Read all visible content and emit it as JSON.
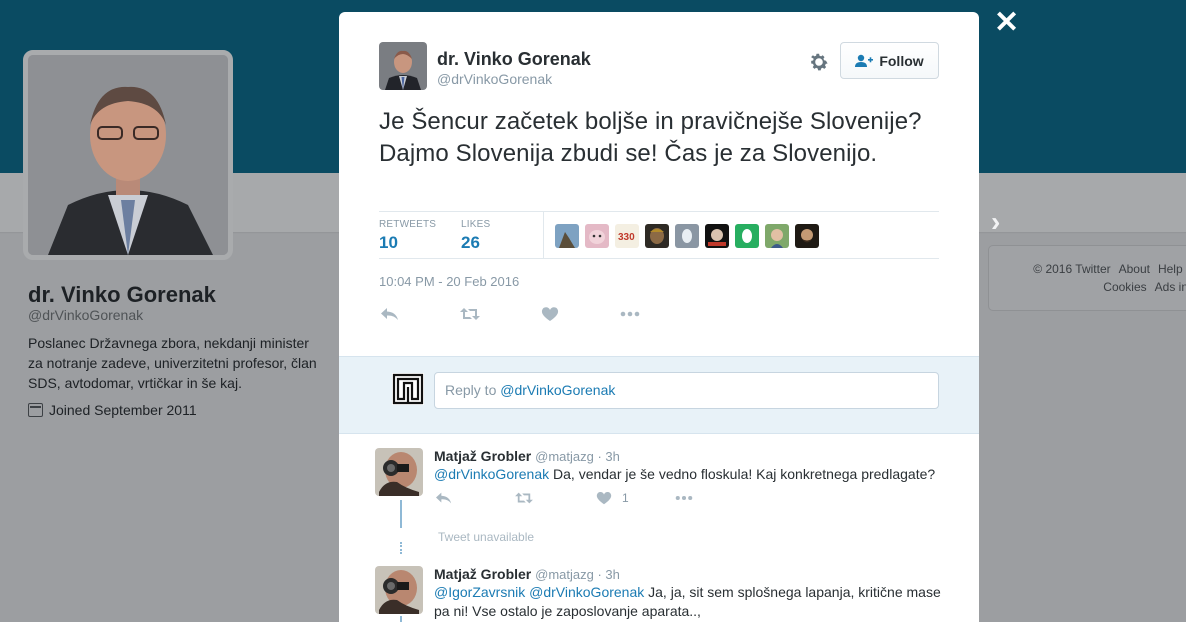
{
  "profile": {
    "name": "dr. Vinko Gorenak",
    "handle": "@drVinkoGorenak",
    "bio": "Poslanec Državnega zbora, nekdanji minister za notranje zadeve, univerzitetni profesor, član SDS, avtodomar, vrtičkar in še kaj.",
    "joined": "Joined September 2011"
  },
  "footer": {
    "line1": [
      "© 2016 Twitter",
      "About",
      "Help",
      "T"
    ],
    "line2": [
      "Cookies",
      "Ads info"
    ]
  },
  "modal": {
    "author_name": "dr. Vinko Gorenak",
    "author_handle": "@drVinkoGorenak",
    "follow_label": "Follow",
    "tweet_text": "Je Šencur začetek boljše in pravičnejše Slovenije? Dajmo Slovenija zbudi se! Čas je za Slovenijo.",
    "retweets_label": "RETWEETS",
    "retweets_count": "10",
    "likes_label": "LIKES",
    "likes_count": "26",
    "timestamp": "10:04 PM - 20 Feb 2016",
    "reply_placeholder_prefix": "Reply to ",
    "reply_placeholder_mention": "@drVinkoGorenak"
  },
  "replies": [
    {
      "name": "Matjaž Grobler",
      "meta": "@matjazg · 3h",
      "mentions": "@drVinkoGorenak",
      "text": " Da, vendar je še vedno floskula! Kaj konkretnega predlagate?",
      "likes": "1"
    },
    {
      "name": "Matjaž Grobler",
      "meta": "@matjazg · 3h",
      "mentions": "@IgorZavrsnik @drVinkoGorenak",
      "text": " Ja, ja, sit sem splošnega lapanja, kritične mase pa ni! Vse ostalo je zaposlovanje aparata..,",
      "likes": ""
    }
  ],
  "tweet_unavailable": "Tweet unavailable",
  "colors": {
    "header_bg": "#0a4b62",
    "link_blue": "#1b7bb3",
    "muted": "#8899a6",
    "text": "#292f33"
  }
}
